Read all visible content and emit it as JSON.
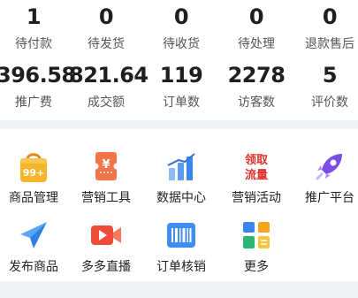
{
  "order_stats": [
    {
      "value": "1",
      "label": "待付款"
    },
    {
      "value": "0",
      "label": "待发货"
    },
    {
      "value": "0",
      "label": "待收货"
    },
    {
      "value": "0",
      "label": "待处理"
    },
    {
      "value": "0",
      "label": "退款售后"
    }
  ],
  "metrics": [
    {
      "value": "396.58",
      "label": "推广费"
    },
    {
      "value": "821.64",
      "label": "成交额"
    },
    {
      "value": "119",
      "label": "订单数"
    },
    {
      "value": "2278",
      "label": "访客数"
    },
    {
      "value": "5",
      "label": "评价数"
    }
  ],
  "tools": [
    {
      "label": "商品管理",
      "icon": "shopping-bag-icon",
      "badge": "99+"
    },
    {
      "label": "营销工具",
      "icon": "coupon-icon",
      "badge": "¥"
    },
    {
      "label": "数据中心",
      "icon": "bar-chart-icon"
    },
    {
      "label": "营销活动",
      "icon": "promo-tag-icon",
      "icon_text": "领取流量"
    },
    {
      "label": "推广平台",
      "icon": "rocket-icon"
    },
    {
      "label": "发布商品",
      "icon": "paper-plane-icon"
    },
    {
      "label": "多多直播",
      "icon": "live-video-icon"
    },
    {
      "label": "订单核销",
      "icon": "barcode-scan-icon"
    },
    {
      "label": "更多",
      "icon": "more-apps-icon"
    }
  ],
  "colors": {
    "orange": "#f5a41b",
    "red": "#ea4a3a",
    "blue": "#3a86f0",
    "purple": "#7a4dea"
  }
}
